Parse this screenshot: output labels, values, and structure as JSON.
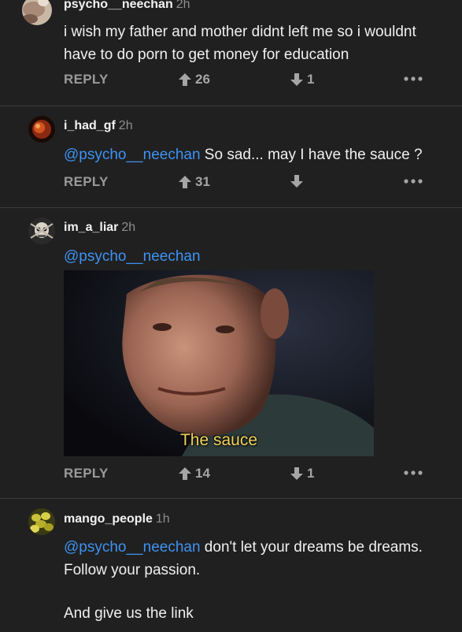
{
  "comments": [
    {
      "username": "psycho__neechan",
      "time": "2h",
      "text_line1": "i wish my father and mother didnt left me so i wouldnt",
      "text_line2": "have to do porn to get money for education",
      "reply_label": "REPLY",
      "upvotes": "26",
      "downvotes": "1"
    },
    {
      "username": "i_had_gf",
      "time": "2h",
      "mention": "@psycho__neechan",
      "text": " So sad... may I have the sauce ?",
      "reply_label": "REPLY",
      "upvotes": "31",
      "downvotes": ""
    },
    {
      "username": "im_a_liar",
      "time": "2h",
      "mention": "@psycho__neechan",
      "image_caption": "The sauce",
      "reply_label": "REPLY",
      "upvotes": "14",
      "downvotes": "1"
    },
    {
      "username": "mango_people",
      "time": "1h",
      "mention": "@psycho__neechan",
      "text_line1": " don't let your dreams be dreams.",
      "text_line2": "Follow your passion.",
      "text_line3": "And give us the link"
    }
  ],
  "colors": {
    "background": "#202020",
    "mention": "#3f92f2",
    "caption": "#f2d25a",
    "muted": "#9a9a9a"
  },
  "icons": [
    "avatar-image",
    "upvote-arrow-icon",
    "downvote-arrow-icon",
    "more-dots-icon"
  ]
}
